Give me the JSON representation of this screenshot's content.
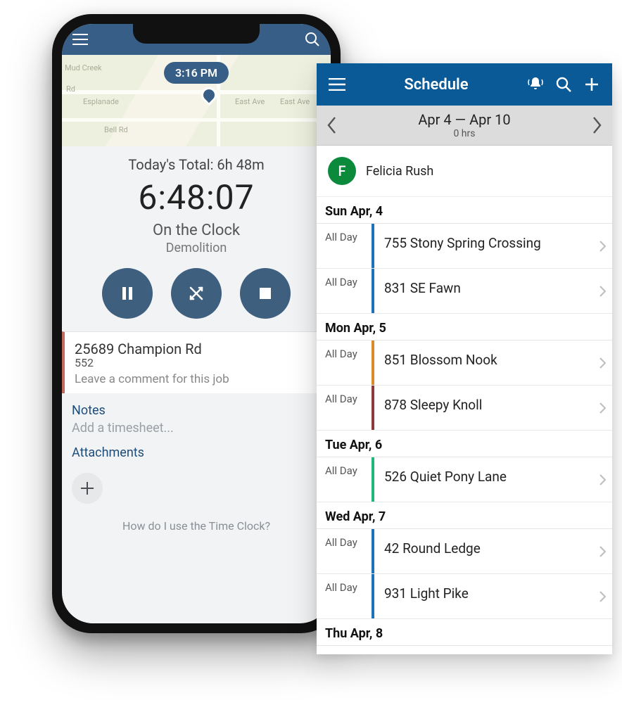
{
  "colors": {
    "phoneHeader": "#375e86",
    "phoneBtn": "#3f5f7f",
    "schedHeader": "#0a5a97",
    "avatar": "#0b8a3c",
    "jobAccent": "#c36b5f"
  },
  "phone": {
    "mapTime": "3:16 PM",
    "mapLabels": {
      "mudCreek": "Mud Creek",
      "esplanade": "Esplanade",
      "bellRd": "Bell Rd",
      "eastAve1": "East Ave",
      "eastAve2": "East Ave",
      "rd": "Rd"
    },
    "todayTotalLabel": "Today's Total: 6h 48m",
    "elapsed": "6:48:07",
    "status": "On the Clock",
    "task": "Demolition",
    "job": {
      "address": "25689 Champion Rd",
      "number": "552",
      "commentPlaceholder": "Leave a comment for this job"
    },
    "notesHeader": "Notes",
    "notesPlaceholder": "Add a timesheet...",
    "attachmentsHeader": "Attachments",
    "helpText": "How do I use the Time Clock?"
  },
  "schedule": {
    "title": "Schedule",
    "rangeLabel": "Apr 4 — Apr 10",
    "rangeHours": "0 hrs",
    "user": {
      "initial": "F",
      "name": "Felicia Rush"
    },
    "days": [
      {
        "header": "Sun Apr, 4",
        "events": [
          {
            "time": "All Day",
            "title": "755 Stony Spring Crossing",
            "barColor": "#1f72b8"
          },
          {
            "time": "All Day",
            "title": "831 SE Fawn",
            "barColor": "#1f72b8"
          }
        ]
      },
      {
        "header": "Mon Apr, 5",
        "events": [
          {
            "time": "All Day",
            "title": "851 Blossom Nook",
            "barColor": "#d98a2b"
          },
          {
            "time": "All Day",
            "title": "878 Sleepy Knoll",
            "barColor": "#8a3a3a"
          }
        ]
      },
      {
        "header": "Tue Apr, 6",
        "events": [
          {
            "time": "All Day",
            "title": "526 Quiet Pony Lane",
            "barColor": "#1fb87a"
          }
        ]
      },
      {
        "header": "Wed Apr, 7",
        "events": [
          {
            "time": "All Day",
            "title": "42 Round Ledge",
            "barColor": "#1f72b8"
          },
          {
            "time": "All Day",
            "title": "931 Light Pike",
            "barColor": "#1f72b8"
          }
        ]
      },
      {
        "header": "Thu Apr, 8",
        "events": []
      }
    ]
  }
}
